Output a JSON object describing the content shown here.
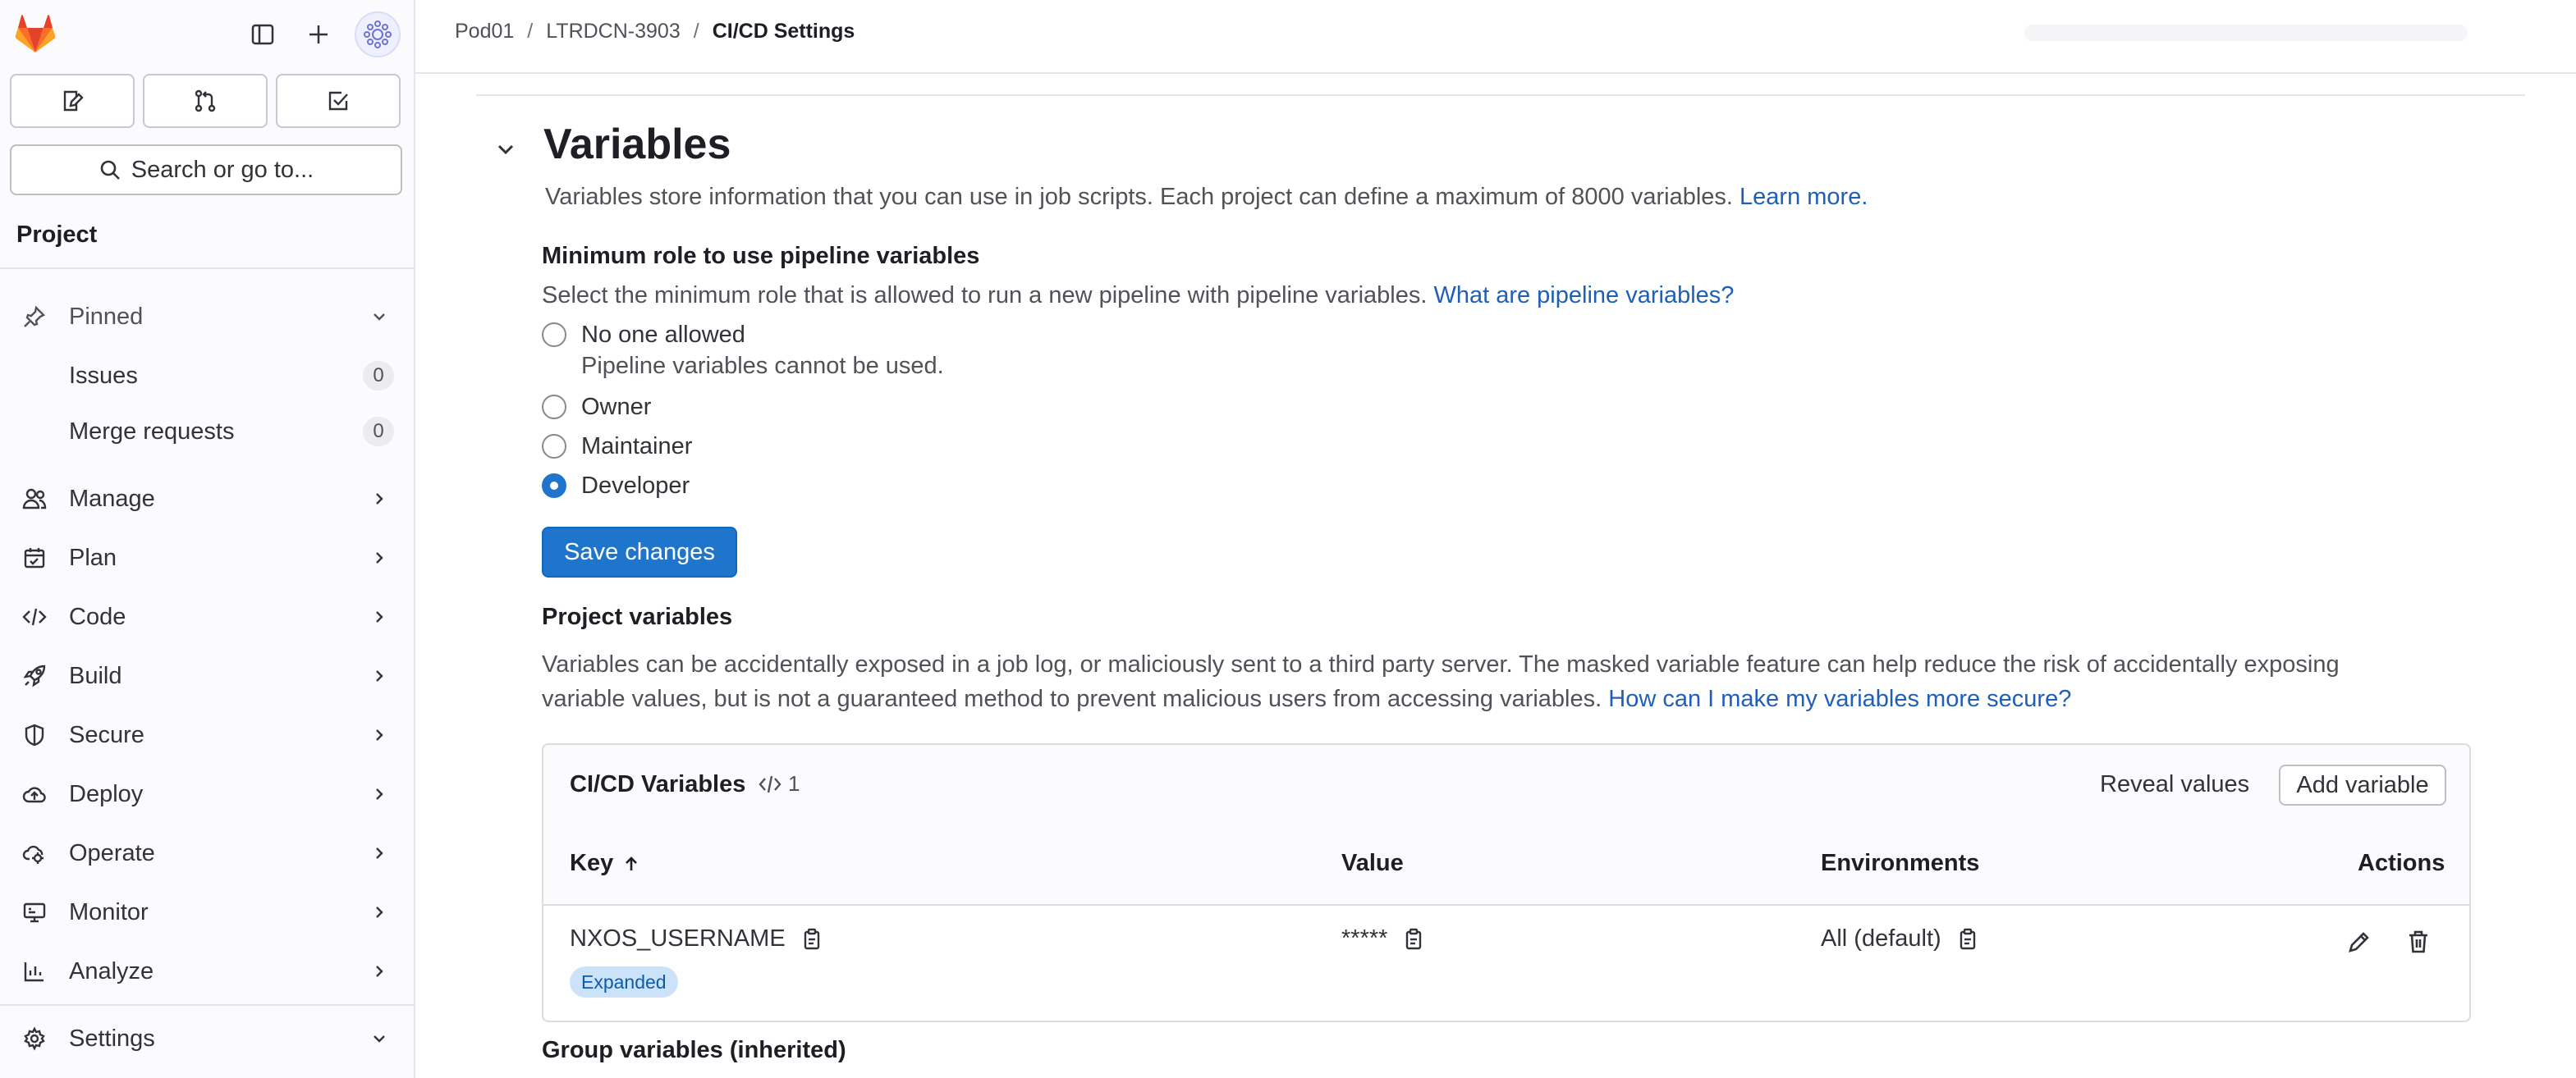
{
  "sidebar": {
    "search_placeholder": "Search or go to...",
    "section_title": "Project",
    "pinned": {
      "label": "Pinned",
      "items": [
        {
          "label": "Issues",
          "count": "0"
        },
        {
          "label": "Merge requests",
          "count": "0"
        }
      ]
    },
    "items": [
      {
        "label": "Manage",
        "icon": "users-icon"
      },
      {
        "label": "Plan",
        "icon": "calendar-icon"
      },
      {
        "label": "Code",
        "icon": "code-icon"
      },
      {
        "label": "Build",
        "icon": "rocket-icon"
      },
      {
        "label": "Secure",
        "icon": "shield-icon"
      },
      {
        "label": "Deploy",
        "icon": "deploy-icon"
      },
      {
        "label": "Operate",
        "icon": "cloud-gear-icon"
      },
      {
        "label": "Monitor",
        "icon": "monitor-icon"
      },
      {
        "label": "Analyze",
        "icon": "chart-icon"
      }
    ],
    "settings": {
      "label": "Settings",
      "icon": "gear-icon"
    }
  },
  "header": {
    "breadcrumbs": [
      "Pod01",
      "LTRDCN-3903",
      "CI/CD Settings"
    ],
    "separator": "/"
  },
  "main": {
    "title": "Variables",
    "description": "Variables store information that you can use in job scripts. Each project can define a maximum of 8000 variables.",
    "description_link": "Learn more.",
    "min_role": {
      "heading": "Minimum role to use pipeline variables",
      "help": "Select the minimum role that is allowed to run a new pipeline with pipeline variables.",
      "help_link": "What are pipeline variables?",
      "options": [
        {
          "label": "No one allowed",
          "selected": false,
          "help": "Pipeline variables cannot be used."
        },
        {
          "label": "Owner",
          "selected": false
        },
        {
          "label": "Maintainer",
          "selected": false
        },
        {
          "label": "Developer",
          "selected": true
        }
      ],
      "save_label": "Save changes"
    },
    "project_variables": {
      "heading": "Project variables",
      "text_line1": "Variables can be accidentally exposed in a job log, or maliciously sent to a third party server. The masked variable feature can help reduce the risk of accidentally exposing",
      "text_line2": "variable values, but is not a guaranteed method to prevent malicious users from accessing variables.",
      "link": "How can I make my variables more secure?"
    },
    "card": {
      "title": "CI/CD Variables",
      "count": "1",
      "reveal_label": "Reveal values",
      "add_label": "Add variable",
      "columns": {
        "key": "Key",
        "value": "Value",
        "environments": "Environments",
        "actions": "Actions"
      },
      "rows": [
        {
          "key": "NXOS_USERNAME",
          "badge": "Expanded",
          "value": "*****",
          "environment": "All (default)"
        }
      ]
    },
    "group_variables_heading": "Group variables (inherited)"
  },
  "colors": {
    "accent": "#1f75cb",
    "link": "#1f5fb8",
    "badge_bg": "#cbe2f9",
    "badge_fg": "#0b5cad"
  }
}
